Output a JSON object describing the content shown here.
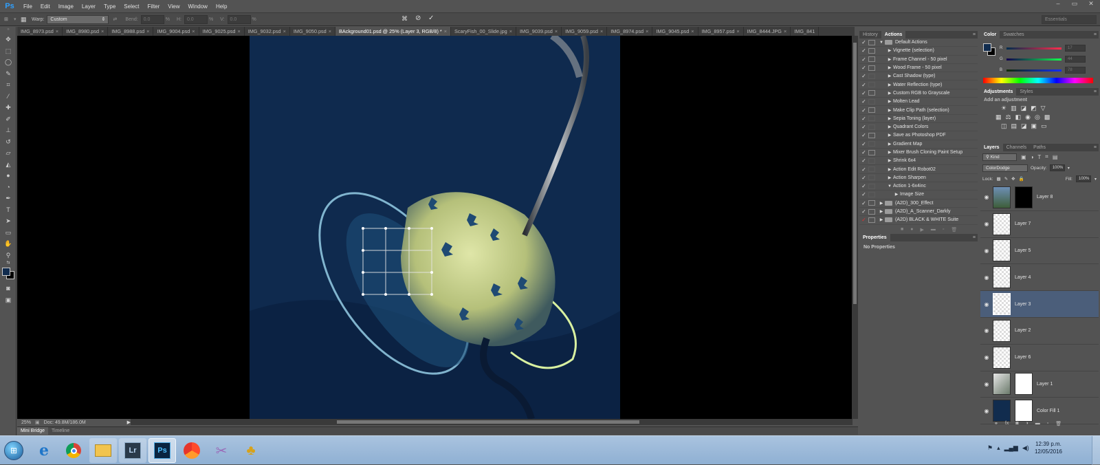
{
  "app": {
    "logo": "Ps"
  },
  "menu": [
    "File",
    "Edit",
    "Image",
    "Layer",
    "Type",
    "Select",
    "Filter",
    "View",
    "Window",
    "Help"
  ],
  "window_controls": {
    "minimize": "–",
    "restore": "▭",
    "close": "✕"
  },
  "options": {
    "warp_label": "Warp:",
    "warp_value": "Custom",
    "bend_label": "Bend:",
    "bend_value": "0.0",
    "bend_unit": "%",
    "h_label": "H:",
    "h_value": "0.0",
    "h_unit": "%",
    "v_label": "V:",
    "v_value": "0.0",
    "v_unit": "%",
    "workspace": "Essentials"
  },
  "tabs": [
    {
      "label": "IMG_8973.psd",
      "active": false
    },
    {
      "label": "IMG_8980.psd",
      "active": false
    },
    {
      "label": "IMG_8988.psd",
      "active": false
    },
    {
      "label": "IMG_9004.psd",
      "active": false
    },
    {
      "label": "IMG_9025.psd",
      "active": false
    },
    {
      "label": "IMG_9032.psd",
      "active": false
    },
    {
      "label": "IMG_9050.psd",
      "active": false
    },
    {
      "label": "BAckground01.psd @ 25% (Layer 3, RGB/8) *",
      "active": true
    },
    {
      "label": "ScaryFish_00_Slide.jpg",
      "active": false
    },
    {
      "label": "IMG_9039.psd",
      "active": false
    },
    {
      "label": "IMG_9059.psd",
      "active": false
    },
    {
      "label": "IMG_8974.psd",
      "active": false
    },
    {
      "label": "IMG_9045.psd",
      "active": false
    },
    {
      "label": "IMG_8957.psd",
      "active": false
    },
    {
      "label": "IMG_8444.JPG",
      "active": false
    },
    {
      "label": "IMG_841",
      "active": false
    }
  ],
  "status": {
    "zoom": "25%",
    "doc": "Doc: 49.8M/186.0M"
  },
  "bottom_tabs": [
    "Mini Bridge",
    "Timeline"
  ],
  "history_actions": {
    "tabs": [
      "History",
      "Actions"
    ],
    "set_name": "Default Actions",
    "items": [
      "Vignette (selection)",
      "Frame Channel - 50 pixel",
      "Wood Frame - 50 pixel",
      "Cast Shadow (type)",
      "Water Reflection (type)",
      "Custom RGB to Grayscale",
      "Molten Lead",
      "Make Clip Path (selection)",
      "Sepia Toning (layer)",
      "Quadrant Colors",
      "Save as Photoshop PDF",
      "Gradient Map",
      "Mixer Brush Cloning Paint Setup",
      "Shrink 6x4",
      "Action Edit Robot02",
      "Action Sharpen",
      "Action 1-6x4inc"
    ],
    "sub_item": "Image Size",
    "sets": [
      "(A2D)_300_Effect",
      "(A2D)_A_Scanner_Darkly",
      "(A2D) BLACK & WHITE Suite"
    ]
  },
  "properties": {
    "title": "Properties",
    "text": "No Properties"
  },
  "color_panel": {
    "tabs": [
      "Color",
      "Swatches"
    ],
    "r_label": "R",
    "r_value": "17",
    "g_label": "G",
    "g_value": "44",
    "b_label": "B",
    "b_value": "78",
    "r": 17,
    "g": 44,
    "b": 78,
    "fg_color": "#112c4e",
    "bg_color": "#000000"
  },
  "adjustments": {
    "tabs": [
      "Adjustments",
      "Styles"
    ],
    "hint": "Add an adjustment"
  },
  "layers_panel": {
    "tabs": [
      "Layers",
      "Channels",
      "Paths"
    ],
    "kind": "Kind",
    "blend_mode": "ColorDodge",
    "opacity_label": "Opacity:",
    "opacity": "100%",
    "lock_label": "Lock:",
    "fill_label": "Fill:",
    "fill": "100%",
    "layers": [
      {
        "name": "Layer 8",
        "selected": false
      },
      {
        "name": "Layer 7",
        "selected": false
      },
      {
        "name": "Layer 5",
        "selected": false
      },
      {
        "name": "Layer 4",
        "selected": false
      },
      {
        "name": "Layer 3",
        "selected": true
      },
      {
        "name": "Layer 2",
        "selected": false
      },
      {
        "name": "Layer 6",
        "selected": false
      },
      {
        "name": "Layer 1",
        "selected": false
      },
      {
        "name": "Color Fill 1",
        "selected": false
      }
    ]
  },
  "taskbar": {
    "apps": [
      "start",
      "ie",
      "chrome",
      "explorer",
      "lightroom",
      "photoshop",
      "app7",
      "app8",
      "app9"
    ],
    "lightroom_label": "Lr",
    "photoshop_label": "Ps",
    "time": "12:39 p.m.",
    "date": "12/05/2016"
  }
}
